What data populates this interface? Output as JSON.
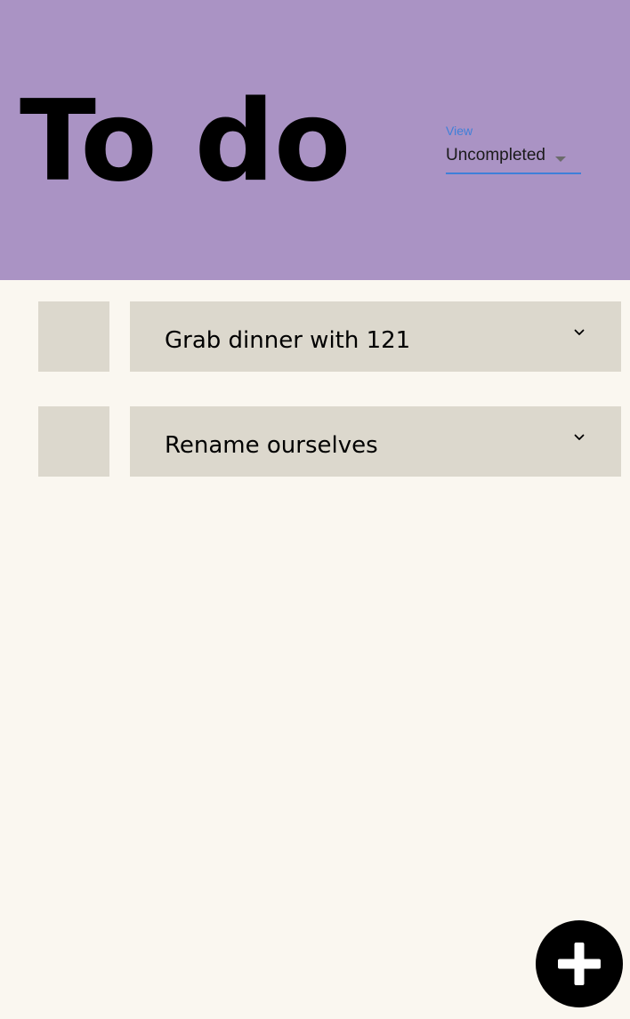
{
  "header": {
    "title": "To do",
    "background_color": "#aa93c4"
  },
  "view_select": {
    "label": "View",
    "value": "Uncompleted",
    "accent_color": "#3f7fd9",
    "icon": "dropdown-arrow-icon"
  },
  "todos": [
    {
      "title": "Grab dinner with 121",
      "completed": false,
      "icon": "chevron-down-icon"
    },
    {
      "title": "Rename ourselves",
      "completed": false,
      "icon": "chevron-down-icon"
    }
  ],
  "add_button": {
    "icon": "plus-icon",
    "color": "#000000"
  },
  "colors": {
    "page_background": "#faf7f0",
    "card_background": "#dcd8cd"
  }
}
